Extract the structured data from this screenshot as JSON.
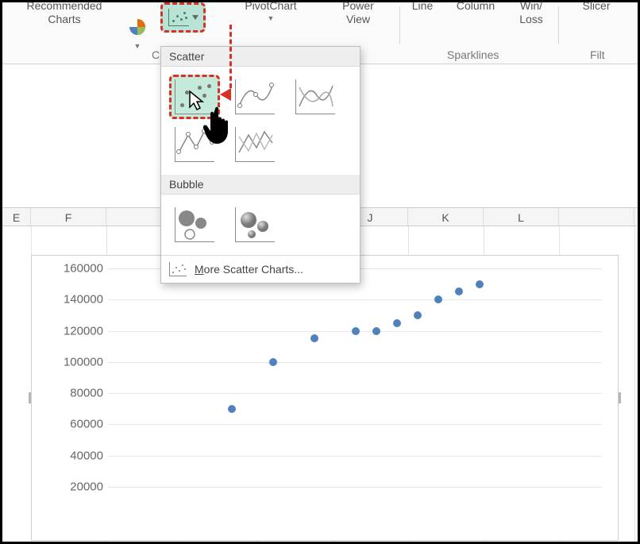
{
  "ribbon": {
    "recommended": "Recommended\nCharts",
    "pivot": "PivotChart",
    "power": "Power\nView",
    "line": "Line",
    "column": "Column",
    "winloss": "Win/\nLoss",
    "slicer": "Slicer",
    "group_cha": "Cha",
    "group_spark": "Sparklines",
    "group_filt": "Filt"
  },
  "dropdown": {
    "scatter_header": "Scatter",
    "bubble_header": "Bubble",
    "more_prefix": "M",
    "more_rest": "ore Scatter Charts..."
  },
  "columns": [
    "E",
    "F",
    "",
    "",
    "",
    "J",
    "K",
    "L",
    ""
  ],
  "chart_data": {
    "type": "scatter",
    "title": "",
    "xlabel": "",
    "ylabel": "",
    "ylim": [
      0,
      160000
    ],
    "yticks": [
      20000,
      40000,
      60000,
      80000,
      100000,
      120000,
      140000,
      160000
    ],
    "x": [
      3,
      4,
      5,
      6,
      6.5,
      7,
      7.5,
      8,
      8.5,
      9
    ],
    "values": [
      70000,
      100000,
      115000,
      120000,
      120000,
      125000,
      130000,
      140000,
      145000,
      150000
    ]
  }
}
